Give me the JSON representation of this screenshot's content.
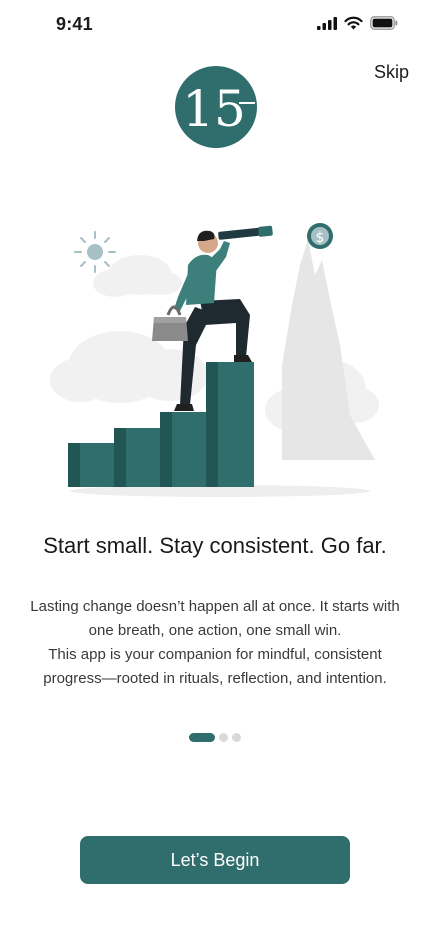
{
  "status_bar": {
    "time": "9:41"
  },
  "header": {
    "skip_label": "Skip"
  },
  "logo": {
    "text": "15"
  },
  "onboarding": {
    "headline": "Start small. Stay consistent. Go far.",
    "description_lines": [
      "Lasting change doesn’t happen all at once. It starts with one breath, one action, one small win.",
      "This app is your companion for mindful, consistent progress—rooted in rituals, reflection, and intention."
    ],
    "page_indicator": {
      "current": 1,
      "total": 3
    }
  },
  "cta": {
    "label": "Let’s Begin"
  },
  "colors": {
    "primary": "#2f6e6c",
    "inactive_dot": "#d9d9d9",
    "background": "#ffffff"
  },
  "icons": [
    "signal-icon",
    "wifi-icon",
    "battery-icon",
    "sun-icon",
    "dollar-coin-icon",
    "telescope-icon",
    "handbag-icon"
  ]
}
